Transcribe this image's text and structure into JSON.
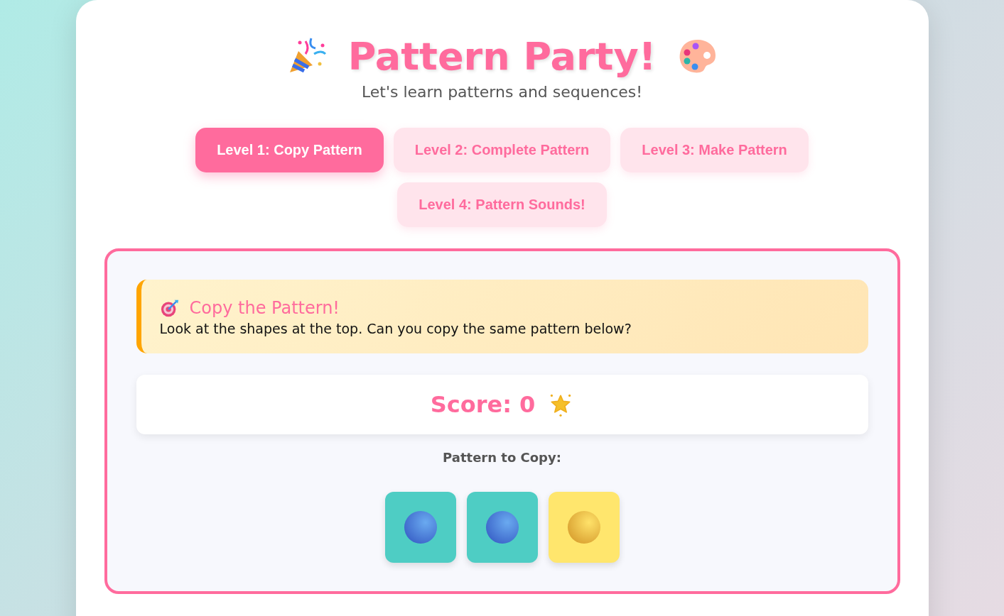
{
  "header": {
    "title": "Pattern Party!",
    "subtitle": "Let's learn patterns and sequences!"
  },
  "levels": [
    {
      "label": "Level 1: Copy Pattern",
      "selected": true
    },
    {
      "label": "Level 2: Complete Pattern",
      "selected": false
    },
    {
      "label": "Level 3: Make Pattern",
      "selected": false
    },
    {
      "label": "Level 4: Pattern Sounds!",
      "selected": false
    }
  ],
  "instructions": {
    "title": "Copy the Pattern!",
    "text": "Look at the shapes at the top. Can you copy the same pattern below?"
  },
  "score": "Score: 0",
  "pattern": {
    "label": "Pattern to Copy:",
    "tiles": [
      {
        "kind": "blue",
        "color": "#4ecdc4"
      },
      {
        "kind": "blue",
        "color": "#4ecdc4"
      },
      {
        "kind": "yellow",
        "color": "#ffe66d"
      }
    ]
  }
}
